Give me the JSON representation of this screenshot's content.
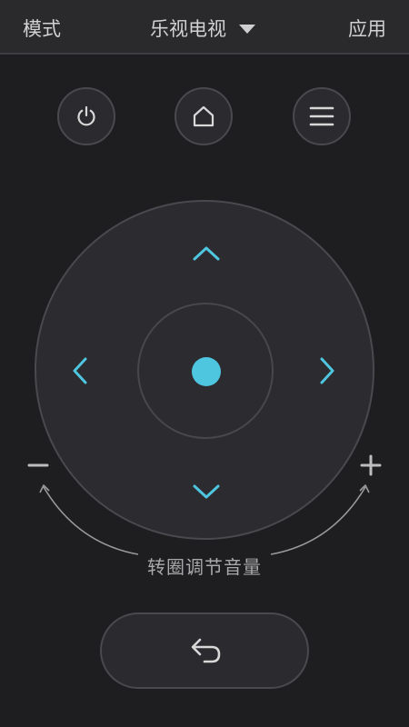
{
  "header": {
    "mode_label": "模式",
    "device_name": "乐视电视",
    "apps_label": "应用"
  },
  "buttons": {
    "power_icon": "power-icon",
    "home_icon": "home-icon",
    "menu_icon": "menu-icon"
  },
  "dpad": {
    "ok_color": "#4fc6e0",
    "arrow_color": "#4fc6e0"
  },
  "volume": {
    "hint": "转圈调节音量"
  },
  "back": {
    "icon": "back-arrow-icon"
  }
}
